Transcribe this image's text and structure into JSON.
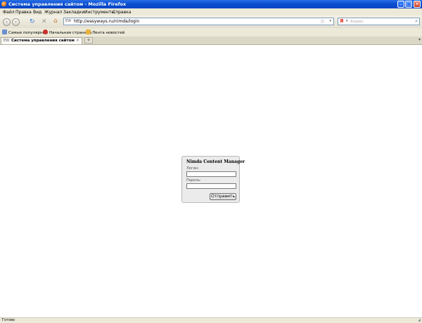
{
  "window": {
    "title": "Система управления сайтом - Mozilla Firefox",
    "minimize": "–",
    "maximize": "□",
    "close": "✕"
  },
  "menu": [
    "Файл",
    "Правка",
    "Вид",
    "Журнал",
    "Закладки",
    "Инструменты",
    "Справка"
  ],
  "nav": {
    "back": "‹",
    "forward": "›",
    "reload": "↻",
    "stop": "✕",
    "home": "⌂",
    "url": "http://easyways.ru/nimda/login",
    "site_icon": "EW",
    "search_engine": "Я",
    "search_placeholder": "Яндекс"
  },
  "bookmarks": [
    "Самые популярные",
    "Начальная страница",
    "Лента новостей"
  ],
  "tabs": [
    {
      "title": "Система управления сайтом",
      "icon": "EW"
    }
  ],
  "login": {
    "title": "Nimda Content Manager",
    "login_label": "Логин:",
    "password_label": "Пароль:",
    "submit_label": "Отправить"
  },
  "status": {
    "text": "Готово"
  },
  "colors": {
    "titlebar": "#0a4fd0",
    "chrome": "#ece9d8",
    "panel": "#ebebeb",
    "yandex_red": "#e0251b"
  },
  "icons": [
    "firefox-icon",
    "back-icon",
    "forward-icon",
    "reload-icon",
    "stop-icon",
    "home-icon",
    "star-icon",
    "search-icon"
  ]
}
